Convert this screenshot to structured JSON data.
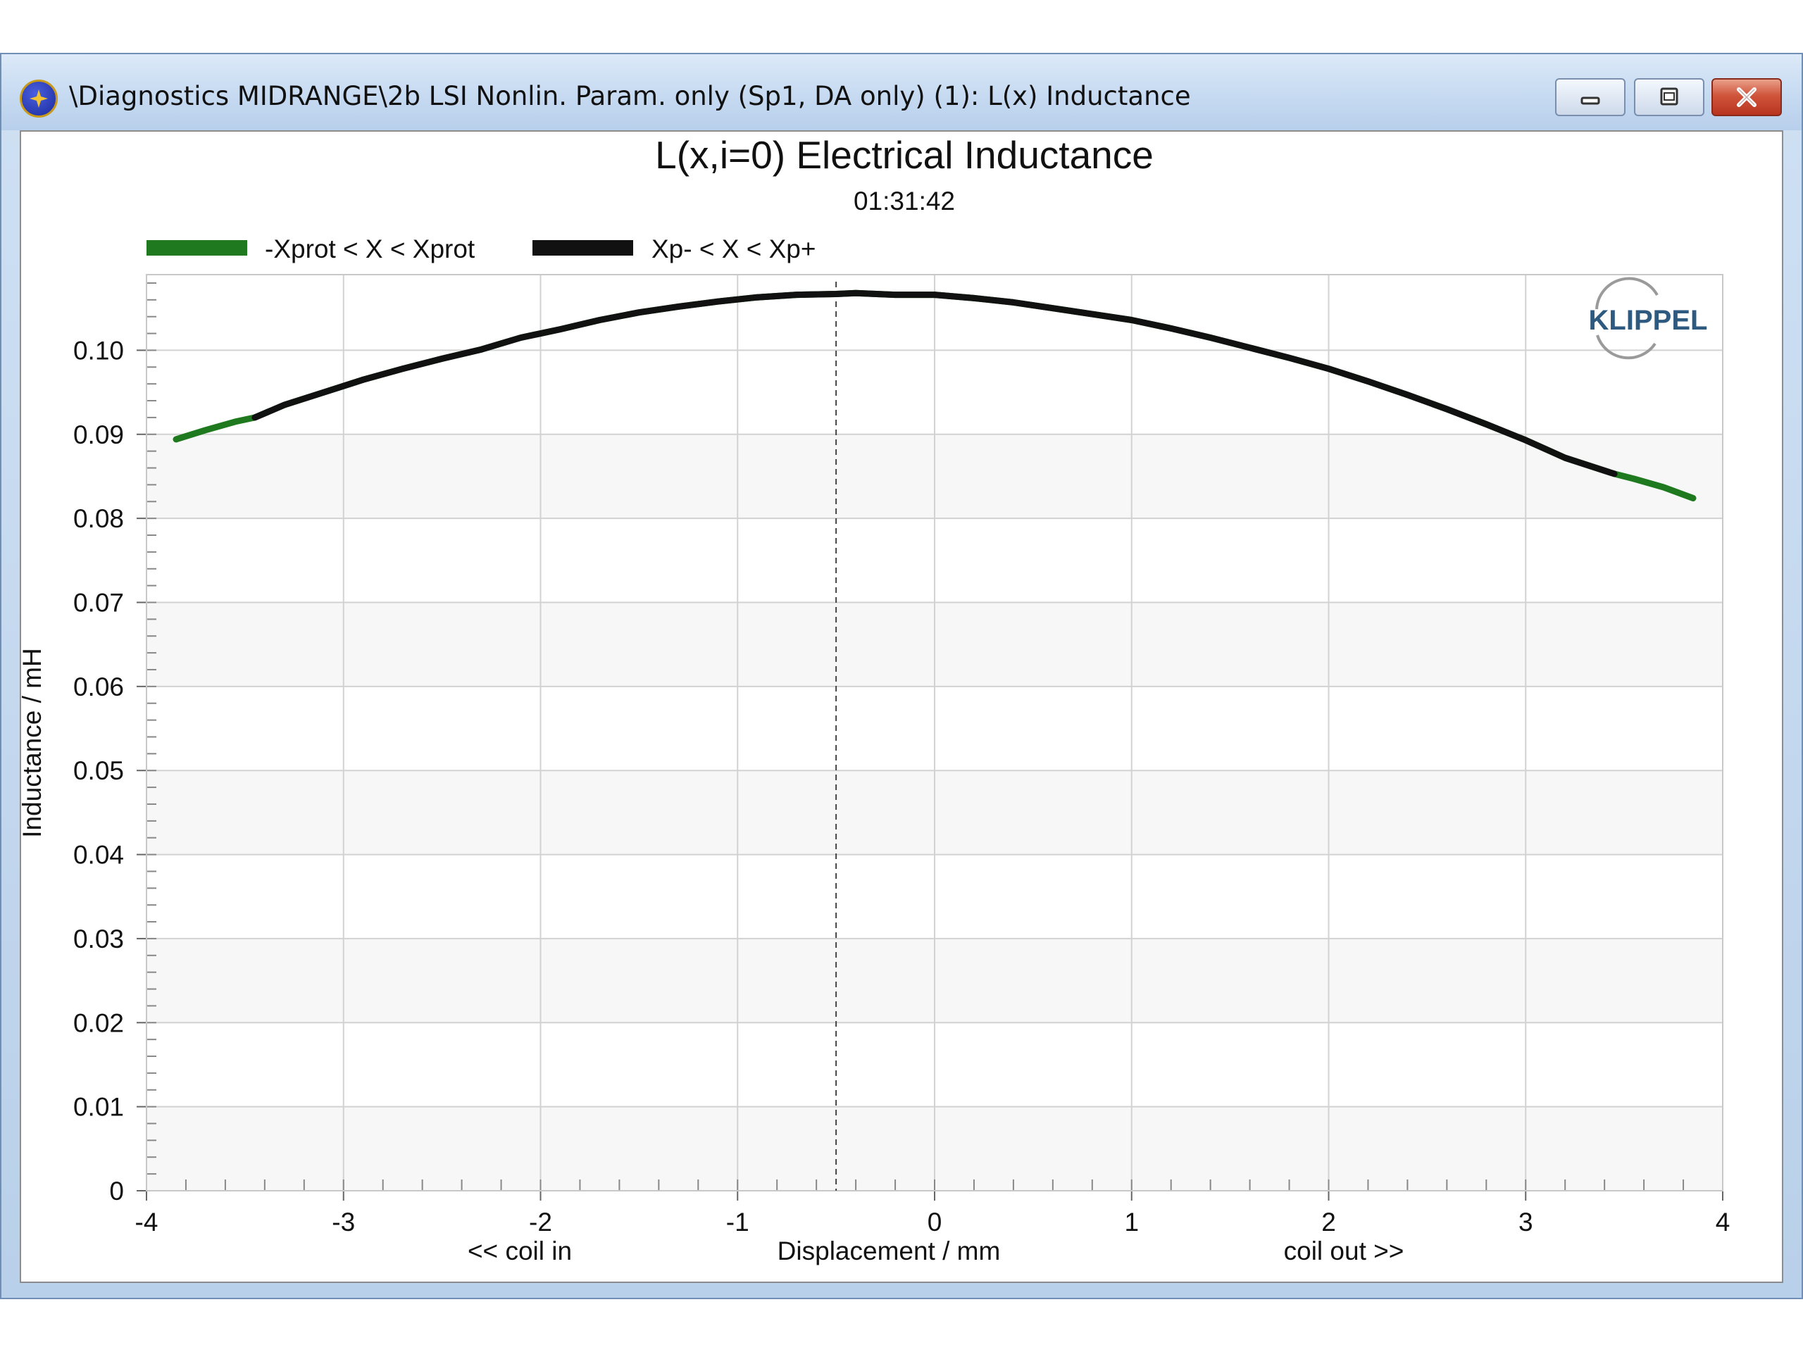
{
  "window": {
    "title": "\\Diagnostics MIDRANGE\\2b LSI Nonlin. Param. only (Sp1, DA only) (1): L(x) Inductance",
    "icon": "klippel-app-icon",
    "buttons": {
      "minimize": "minimize-icon",
      "maximize": "maximize-icon",
      "close": "close-icon"
    },
    "close_color": "#c8442c"
  },
  "logo": {
    "text": "KLIPPEL",
    "color": "#2f5a80"
  },
  "chart_data": {
    "type": "line",
    "title": "L(x,i=0) Electrical Inductance",
    "subtitle": "01:31:42",
    "xlabel": "Displacement / mm",
    "xlabel_left": "<< coil in",
    "xlabel_right": "coil out >>",
    "ylabel": "Inductance / mH",
    "xlim": [
      -4,
      4
    ],
    "ylim": [
      0,
      0.109
    ],
    "x_ticks": [
      -4,
      -3,
      -2,
      -1,
      0,
      1,
      2,
      3,
      4
    ],
    "x_tick_labels": [
      "-4",
      "-3",
      "-2",
      "-1",
      "0",
      "1",
      "2",
      "3",
      "4"
    ],
    "y_ticks": [
      0,
      0.01,
      0.02,
      0.03,
      0.04,
      0.05,
      0.06,
      0.07,
      0.08,
      0.09,
      0.1
    ],
    "y_tick_labels": [
      "0",
      "0.01",
      "0.02",
      "0.03",
      "0.04",
      "0.05",
      "0.06",
      "0.07",
      "0.08",
      "0.09",
      "0.10"
    ],
    "grid": true,
    "legend_position": "top-left",
    "marker_x": -0.5,
    "series": [
      {
        "name": "-Xprot < X < Xprot",
        "color": "#1f7a1f",
        "x": [
          -3.85,
          -3.7,
          -3.55,
          -3.45,
          -3.3,
          -3.1,
          -2.9,
          -2.7,
          -2.5,
          -2.3,
          -2.1,
          -1.9,
          -1.7,
          -1.5,
          -1.3,
          -1.1,
          -0.9,
          -0.7,
          -0.5,
          -0.4,
          -0.2,
          0,
          0.2,
          0.4,
          0.6,
          0.8,
          1.0,
          1.2,
          1.4,
          1.6,
          1.8,
          2.0,
          2.2,
          2.4,
          2.6,
          2.8,
          3.0,
          3.2,
          3.45,
          3.55,
          3.7,
          3.85
        ],
        "values": [
          0.0894,
          0.0905,
          0.0915,
          0.092,
          0.0935,
          0.095,
          0.0965,
          0.0978,
          0.099,
          0.1001,
          0.1015,
          0.1025,
          0.1036,
          0.1045,
          0.1052,
          0.1058,
          0.1063,
          0.1066,
          0.1067,
          0.1068,
          0.1066,
          0.1066,
          0.1062,
          0.1057,
          0.105,
          0.1043,
          0.1036,
          0.1026,
          0.1015,
          0.1003,
          0.0991,
          0.0978,
          0.0963,
          0.0947,
          0.093,
          0.0912,
          0.0893,
          0.0872,
          0.0853,
          0.0847,
          0.0837,
          0.0824
        ]
      },
      {
        "name": "Xp- < X < Xp+",
        "color": "#111111",
        "x": [
          -3.45,
          -3.3,
          -3.1,
          -2.9,
          -2.7,
          -2.5,
          -2.3,
          -2.1,
          -1.9,
          -1.7,
          -1.5,
          -1.3,
          -1.1,
          -0.9,
          -0.7,
          -0.5,
          -0.4,
          -0.2,
          0,
          0.2,
          0.4,
          0.6,
          0.8,
          1.0,
          1.2,
          1.4,
          1.6,
          1.8,
          2.0,
          2.2,
          2.4,
          2.6,
          2.8,
          3.0,
          3.2,
          3.45
        ],
        "values": [
          0.092,
          0.0935,
          0.095,
          0.0965,
          0.0978,
          0.099,
          0.1001,
          0.1015,
          0.1025,
          0.1036,
          0.1045,
          0.1052,
          0.1058,
          0.1063,
          0.1066,
          0.1067,
          0.1068,
          0.1066,
          0.1066,
          0.1062,
          0.1057,
          0.105,
          0.1043,
          0.1036,
          0.1026,
          0.1015,
          0.1003,
          0.0991,
          0.0978,
          0.0963,
          0.0947,
          0.093,
          0.0912,
          0.0893,
          0.0872,
          0.0853
        ]
      }
    ]
  }
}
